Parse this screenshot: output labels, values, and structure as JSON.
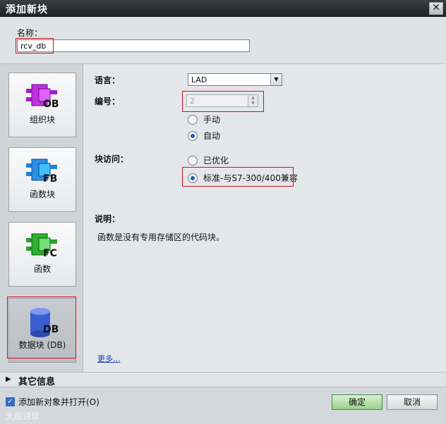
{
  "window": {
    "title": "添加新块",
    "close_symbol": "✕"
  },
  "name": {
    "label": "名称：",
    "value": "rcv_db"
  },
  "block_types": [
    {
      "code": "OB",
      "label": "组织块",
      "color": "#a020c8"
    },
    {
      "code": "FB",
      "label": "函数块",
      "color": "#1e7fd8"
    },
    {
      "code": "FC",
      "label": "函数",
      "color": "#2aa02a"
    },
    {
      "code": "DB",
      "label": "数据块 (DB)",
      "color": "#3a5fd0",
      "selected": true
    }
  ],
  "properties": {
    "language_label": "语言：",
    "language_value": "LAD",
    "number_label": "编号：",
    "number_value": "2",
    "manual_label": "手动",
    "auto_label": "自动",
    "number_mode": "auto",
    "access_label": "块访问：",
    "optimized_label": "已优化",
    "standard_label": "标准-与S7-300/400兼容",
    "access_mode": "standard",
    "desc_label": "说明：",
    "desc_text": "函数是没有专用存储区的代码块。",
    "more_link": "更多..."
  },
  "other_info": {
    "label": "其它信息"
  },
  "footer": {
    "add_open_label": "添加新对象并打开(O)",
    "add_open_checked": true,
    "ok_label": "确定",
    "cancel_label": "取消",
    "watermark": "大般诗琐"
  }
}
